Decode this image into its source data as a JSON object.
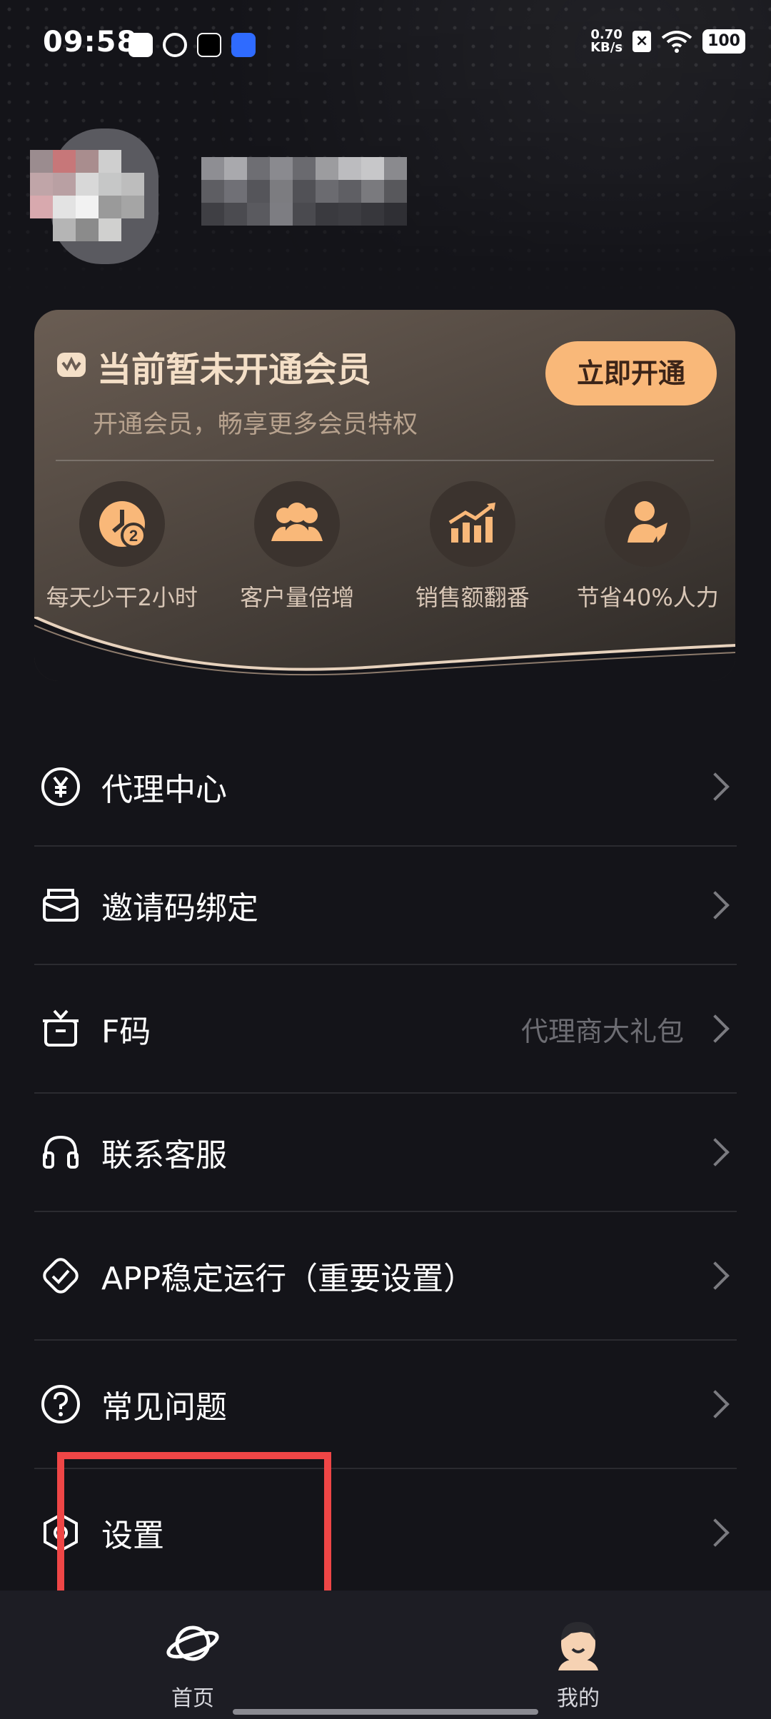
{
  "status_bar": {
    "time": "09:58",
    "net_speed_value": "0.70",
    "net_speed_unit": "KB/s",
    "battery": "100",
    "app_icons": [
      "mail-icon",
      "ball-icon",
      "tiktok-icon",
      "blue-app-icon"
    ]
  },
  "vip": {
    "title": "当前暂未开通会员",
    "subtitle": "开通会员，畅享更多会员特权",
    "button": "立即开通",
    "benefits": [
      {
        "label": "每天少干2小时",
        "icon": "clock-2-icon"
      },
      {
        "label": "客户量倍增",
        "icon": "group-icon"
      },
      {
        "label": "销售额翻番",
        "icon": "chart-up-icon"
      },
      {
        "label": "节省40%人力",
        "icon": "person-icon"
      }
    ],
    "colors": {
      "accent": "#f9b879",
      "title": "#f4dfc7"
    }
  },
  "menu": [
    {
      "label": "代理中心",
      "icon": "yen-icon"
    },
    {
      "label": "邀请码绑定",
      "icon": "envelope-icon"
    },
    {
      "label": "F码",
      "extra": "代理商大礼包",
      "icon": "gift-icon"
    },
    {
      "label": "联系客服",
      "icon": "headset-icon"
    },
    {
      "label": "APP稳定运行（重要设置）",
      "icon": "shield-check-icon"
    },
    {
      "label": "常见问题",
      "icon": "question-icon"
    },
    {
      "label": "设置",
      "icon": "settings-icon"
    }
  ],
  "tabs": [
    {
      "label": "首页",
      "icon": "planet-icon"
    },
    {
      "label": "我的",
      "icon": "profile-face-icon"
    }
  ],
  "highlight_color": "#ef4646"
}
